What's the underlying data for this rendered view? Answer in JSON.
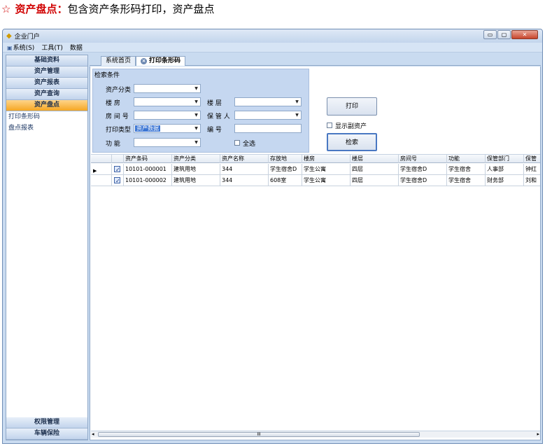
{
  "caption": {
    "star": "☆",
    "heading": "资产盘点：",
    "text": "包含资产条形码打印，资产盘点"
  },
  "window": {
    "title": "企业门户",
    "min": "▭",
    "max": "▢",
    "close": "✕"
  },
  "menu": [
    {
      "label": "系统(S)"
    },
    {
      "label": "工具(T)"
    },
    {
      "label": "数据"
    }
  ],
  "sidebar": {
    "top_buttons": [
      "基础资料",
      "资产管理",
      "资产报表",
      "资产查询",
      "资产盘点"
    ],
    "sub_items": [
      "打印条形码",
      "盘点报表"
    ],
    "bottom_buttons": [
      "权限管理",
      "车辆保险"
    ]
  },
  "tabs": {
    "home": "系统首页",
    "active": "打印条形码"
  },
  "filters": {
    "legend": "检索条件",
    "category": "资产分类",
    "building": "楼    房",
    "floor": "楼    层",
    "room": "房 间 号",
    "keeper": "保 管 人",
    "print_type": "打印类型",
    "print_type_value": "资产数据",
    "number": "编    号",
    "function": "功    能",
    "select_all": "全选"
  },
  "buttons": {
    "print": "打印",
    "show_sub": "显示副资产",
    "search": "检索"
  },
  "grid": {
    "columns": [
      "资产条码",
      "资产分类",
      "资产名称",
      "存放地",
      "楼房",
      "楼层",
      "房间号",
      "功能",
      "保管部门",
      "保管"
    ],
    "rows": [
      {
        "code": "10101-000001",
        "category": "建筑用地",
        "name": "344",
        "location": "学生宿舍D",
        "building": "学生公寓",
        "floor": "四层",
        "room": "学生宿舍D",
        "function": "学生宿舍",
        "dept": "人事部",
        "keeper": "钟红",
        "checked": true
      },
      {
        "code": "10101-000002",
        "category": "建筑用地",
        "name": "344",
        "location": "608室",
        "building": "学生公寓",
        "floor": "四层",
        "room": "学生宿舍D",
        "function": "学生宿舍",
        "dept": "财务部",
        "keeper": "刘和",
        "checked": true
      }
    ]
  },
  "scroll": {
    "left": "◂",
    "right": "▸",
    "grip": "III"
  }
}
